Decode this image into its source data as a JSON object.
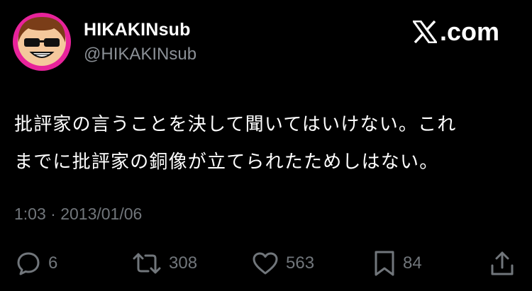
{
  "author": {
    "display_name": "HIKAKINsub",
    "handle": "@HIKAKINsub",
    "avatar_border_color": "#e8239b"
  },
  "brand": {
    "logo_text": ".com",
    "logo_icon": "x-logo-icon"
  },
  "tweet": {
    "lines": [
      "批評家の言うことを決して聞いてはいけない。これ",
      "までに批評家の銅像が立てられたためしはない。"
    ]
  },
  "meta": {
    "timestamp": "1:03 · 2013/01/06"
  },
  "actions": {
    "replies": "6",
    "retweets": "308",
    "likes": "563",
    "bookmarks": "84"
  },
  "colors": {
    "background": "#000000",
    "muted": "#71767b",
    "text": "#ffffff"
  }
}
